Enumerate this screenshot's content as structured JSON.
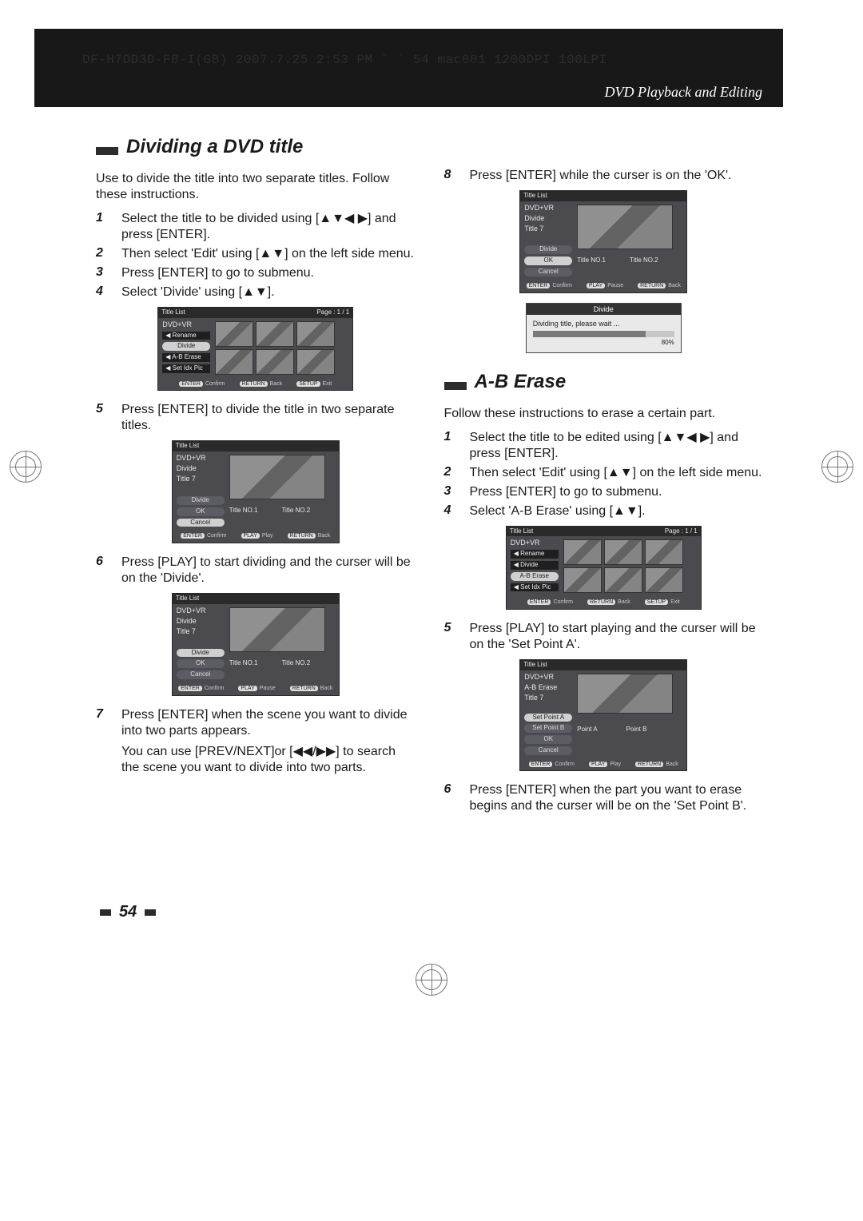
{
  "crop_line": "DF-H7DD3D-FB-I(GB)  2007.7.25 2:53 PM  ˘ ` 54   mac001  1200DPI 100LPI",
  "chapter": "DVD Playback and Editing",
  "page_number": "54",
  "left": {
    "heading": "Dividing a DVD title",
    "intro": "Use to divide the title into two separate titles. Follow these instructions.",
    "s1": "Select the title to be divided using [▲▼◀ ▶] and press [ENTER].",
    "s2": "Then select 'Edit' using [▲▼] on the left side menu.",
    "s3": "Press [ENTER] to go to submenu.",
    "s4": "Select 'Divide' using [▲▼].",
    "s5": "Press [ENTER] to divide the title in two separate titles.",
    "s6": "Press [PLAY] to start dividing and the curser will be on the 'Divide'.",
    "s7": "Press [ENTER] when the scene you want to divide into two parts appears.",
    "s7b": "You can use [PREV/NEXT]or [◀◀/▶▶] to search the scene you want to divide into two parts."
  },
  "right": {
    "s8": "Press [ENTER] while the curser is on the 'OK'.",
    "heading": "A-B Erase",
    "intro": "Follow these instructions to erase a certain part.",
    "s1": "Select the title to be edited using [▲▼◀ ▶] and press [ENTER].",
    "s2": "Then select 'Edit' using [▲▼] on the left side menu.",
    "s3": "Press [ENTER] to go to submenu.",
    "s4": "Select 'A-B Erase' using [▲▼].",
    "s5": "Press [PLAY] to start playing and the curser will be on the 'Set Point A'.",
    "s6": "Press [ENTER] when the part you want to erase begins and the curser will be on the 'Set Point B'."
  },
  "shots": {
    "title_list": "Title List",
    "page_info": "Page : 1 / 1",
    "dvd_vr": "DVD+VR",
    "divide_lbl": "Divide",
    "title_7": "Title 7",
    "btn_divide": "Divide",
    "btn_ok": "OK",
    "btn_cancel": "Cancel",
    "rename": "Rename",
    "ab_erase": "A-B Erase",
    "set_idx": "Set Idx Pic",
    "title_no1": "Title NO.1",
    "title_no2": "Title NO.2",
    "set_a": "Set Point A",
    "set_b": "Set Point B",
    "point_a": "Point A",
    "point_b": "Point B",
    "hint_confirm": "Confirm",
    "hint_play": "Play",
    "hint_pause": "Pause",
    "hint_back": "Back",
    "hint_exit": "Exit",
    "key_enter": "ENTER",
    "key_play": "PLAY",
    "key_return": "RETURN",
    "key_setup": "SETUP",
    "prog_title": "Divide",
    "prog_msg": "Dividing title, please wait ...",
    "prog_pct": "80%",
    "ab_erase_lbl": "A-B Erase"
  }
}
